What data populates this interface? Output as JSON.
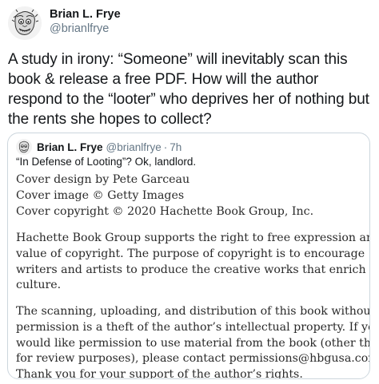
{
  "tweet": {
    "author_name": "Brian L. Frye",
    "author_handle": "@brianlfrye",
    "text": "A study in irony: “Someone” will inevitably scan this book & release a free PDF. How will the author respond to the “looter” who deprives her of nothing but the rents she hopes to collect?"
  },
  "quoted": {
    "author_name": "Brian L. Frye",
    "author_handle": "@brianlfrye",
    "separator": "·",
    "time": "7h",
    "text": "“In Defense of Looting”? Ok, landlord.",
    "book_page": {
      "paragraph1": [
        "Cover design by Pete Garceau",
        "Cover image © Getty Images",
        "Cover copyright © 2020 Hachette Book Group, Inc."
      ],
      "paragraph2": [
        "Hachette Book Group supports the right to free expression and the",
        "value of copyright. The purpose of copyright is to encourage",
        "writers and artists to produce the creative works that enrich our",
        "culture."
      ],
      "paragraph3": [
        "The scanning, uploading, and distribution of this book without",
        "permission is a theft of the author’s intellectual property. If you",
        "would like permission to use material from the book (other than",
        "for review purposes), please contact permissions@hbgusa.com.",
        "Thank you for your support of the author’s rights."
      ]
    }
  }
}
